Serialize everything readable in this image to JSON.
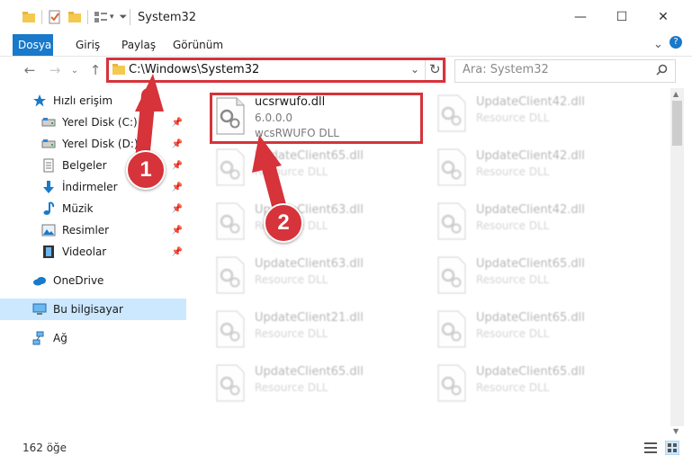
{
  "window": {
    "title": "System32",
    "minimize": "—",
    "maximize": "☐",
    "close": "✕"
  },
  "ribbon": {
    "tabs": [
      "Dosya",
      "Giriş",
      "Paylaş",
      "Görünüm"
    ],
    "expand": "⌄",
    "help": "?"
  },
  "address": {
    "path": "C:\\Windows\\System32",
    "search_placeholder": "Ara: System32"
  },
  "sidebar": {
    "items": [
      {
        "label": "Hızlı erişim",
        "icon": "star-icon",
        "pinned": false
      },
      {
        "label": "Yerel Disk (C:)",
        "icon": "drive-icon",
        "pinned": true
      },
      {
        "label": "Yerel Disk (D:)",
        "icon": "drive-icon",
        "pinned": true
      },
      {
        "label": "Belgeler",
        "icon": "document-icon",
        "pinned": true
      },
      {
        "label": "İndirmeler",
        "icon": "download-icon",
        "pinned": true
      },
      {
        "label": "Müzik",
        "icon": "music-icon",
        "pinned": true
      },
      {
        "label": "Resimler",
        "icon": "picture-icon",
        "pinned": true
      },
      {
        "label": "Videolar",
        "icon": "video-icon",
        "pinned": true
      },
      {
        "label": "OneDrive",
        "icon": "cloud-icon",
        "pinned": false
      },
      {
        "label": "Bu bilgisayar",
        "icon": "computer-icon",
        "pinned": false
      },
      {
        "label": "Ağ",
        "icon": "network-icon",
        "pinned": false
      }
    ]
  },
  "files": {
    "highlighted": {
      "name": "ucsrwufo.dll",
      "version": "6.0.0.0",
      "description": "wcsRWUFO DLL"
    },
    "faded": [
      {
        "name": "UpdateClient42.dll",
        "desc": "Resource DLL"
      },
      {
        "name": "UpdateClient65.dll",
        "desc": "Resource DLL"
      },
      {
        "name": "UpdateClient42.dll",
        "desc": "Resource DLL"
      },
      {
        "name": "UpdateClient63.dll",
        "desc": "Resource DLL"
      },
      {
        "name": "UpdateClient42.dll",
        "desc": "Resource DLL"
      },
      {
        "name": "UpdateClient63.dll",
        "desc": "Resource DLL"
      },
      {
        "name": "UpdateClient65.dll",
        "desc": "Resource DLL"
      },
      {
        "name": "UpdateClient21.dll",
        "desc": "Resource DLL"
      },
      {
        "name": "UpdateClient65.dll",
        "desc": "Resource DLL"
      },
      {
        "name": "UpdateClient65.dll",
        "desc": "Resource DLL"
      },
      {
        "name": "UpdateClient65.dll",
        "desc": "Resource DLL"
      }
    ]
  },
  "status": {
    "count": "162 öğe"
  },
  "annotations": {
    "step1": "1",
    "step2": "2",
    "color": "#d6333a"
  }
}
